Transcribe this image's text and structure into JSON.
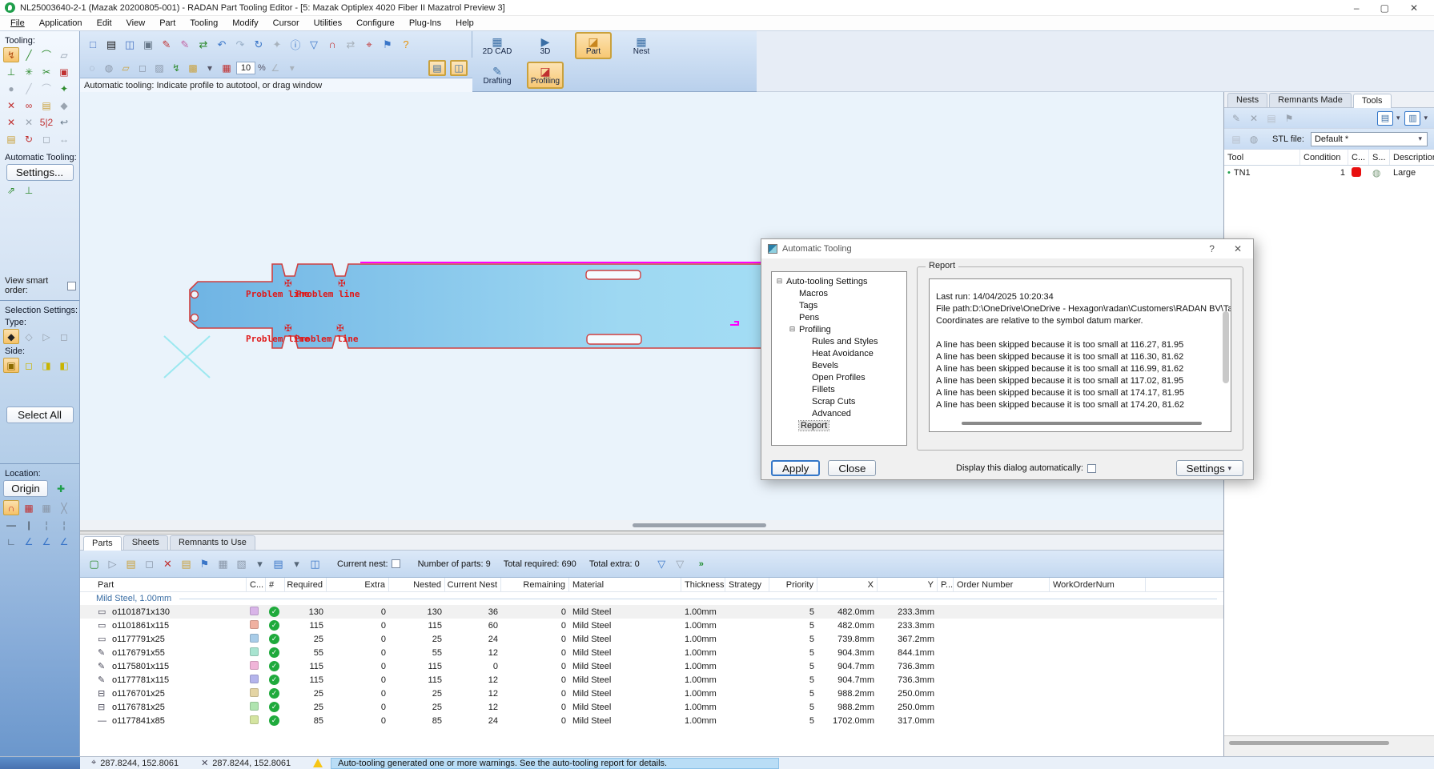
{
  "window": {
    "title": "NL25003640-2-1 (Mazak 20200805-001) - RADAN Part Tooling Editor - [5: Mazak Optiplex 4020 Fiber II Mazatrol Preview 3]",
    "minimize": "–",
    "maximize": "▢",
    "close": "✕"
  },
  "menubar": {
    "items": [
      {
        "label": "File"
      },
      {
        "label": "Application"
      },
      {
        "label": "Edit"
      },
      {
        "label": "View"
      },
      {
        "label": "Part"
      },
      {
        "label": "Tooling"
      },
      {
        "label": "Modify"
      },
      {
        "label": "Cursor"
      },
      {
        "label": "Utilities"
      },
      {
        "label": "Configure"
      },
      {
        "label": "Plug-Ins"
      },
      {
        "label": "Help"
      }
    ]
  },
  "toolbar_main": {
    "icons": [
      {
        "n": "new-file-icon",
        "g": "□",
        "c": "#4a76c4"
      },
      {
        "n": "open-file-icon",
        "g": "▤",
        "c": "#d8a padding",
        "c2": ""
      },
      {
        "n": "save-file-icon",
        "g": "◫",
        "c": "#4a76c4"
      },
      {
        "n": "print-icon",
        "g": "▣",
        "c": "#667788"
      },
      {
        "n": "edit-pencil-icon",
        "g": "✎",
        "c": "#c03030"
      },
      {
        "n": "style-pencil-icon",
        "g": "✎",
        "c": "#c060a0"
      },
      {
        "n": "swap-tools-icon",
        "g": "⇄",
        "c": "#2e8b2e"
      },
      {
        "n": "undo-icon",
        "g": "↶",
        "c": "#3a76c8"
      },
      {
        "n": "redo-icon",
        "g": "↷",
        "c": "#9ab0c8"
      },
      {
        "n": "refresh-icon",
        "g": "↻",
        "c": "#3a76c8"
      },
      {
        "n": "sparkle-icon",
        "g": "✦",
        "c": "#a8b2bc"
      },
      {
        "n": "info-icon",
        "g": "ⓘ",
        "c": "#3a76c8"
      },
      {
        "n": "filter-icon",
        "g": "▽",
        "c": "#3a76c8"
      },
      {
        "n": "magnet-icon",
        "g": "∩",
        "c": "#c03030"
      },
      {
        "n": "measure-icon",
        "g": "⇄",
        "c": "#a8b2bc"
      },
      {
        "n": "inspect-icon",
        "g": "⌖",
        "c": "#c03030"
      },
      {
        "n": "flag-icon",
        "g": "⚑",
        "c": "#3a76c8"
      },
      {
        "n": "help-icon",
        "g": "?",
        "c": "#e8940a"
      }
    ]
  },
  "toolbar_second": {
    "icons": [
      {
        "n": "ghost-select-icon",
        "g": "◌",
        "c": "#8a97a8"
      },
      {
        "n": "ghost-move-icon",
        "g": "◍",
        "c": "#8a97a8"
      },
      {
        "n": "ghost-pan-icon",
        "g": "▱",
        "c": "#caa13c"
      },
      {
        "n": "ghost-copy-icon",
        "g": "◻",
        "c": "#8a97a8"
      },
      {
        "n": "ghost-check-icon",
        "g": "▨",
        "c": "#8a97a8"
      },
      {
        "n": "flash-tool-icon",
        "g": "↯",
        "c": "#2e8b2e"
      },
      {
        "n": "home-view-icon",
        "g": "▩",
        "c": "#caa13c"
      },
      {
        "n": "dropdown-icon",
        "g": "▾",
        "c": "#556"
      },
      {
        "n": "zoom-grid-icon",
        "g": "▦",
        "c": "#c03030"
      }
    ],
    "zoom_value": "10",
    "percent": "%",
    "tail_icons": [
      {
        "n": "angle-snap-icon",
        "g": "∠",
        "c": "#a8b2bc"
      },
      {
        "n": "dropdown-icon",
        "g": "▾",
        "c": "#a8b2bc"
      }
    ],
    "toggle1": "▤",
    "toggle2": "◫"
  },
  "mode_buttons": {
    "cad": {
      "label": "2D CAD",
      "glyph": "▦"
    },
    "threed": {
      "label": "3D",
      "glyph": "▶"
    },
    "part": {
      "label": "Part",
      "glyph": "◪"
    },
    "nest": {
      "label": "Nest",
      "glyph": "▦"
    },
    "drafting": {
      "label": "Drafting",
      "glyph": "✎"
    },
    "profiling": {
      "label": "Profiling",
      "glyph": "◪"
    }
  },
  "hint": "Automatic tooling: Indicate profile to autotool, or drag window",
  "left_palette": {
    "tooling_label": "Tooling:",
    "tool_icons": [
      {
        "n": "autotool-icon",
        "g": "↯",
        "c": "#b04a10",
        "cls": "sel"
      },
      {
        "n": "tool-line-icon",
        "g": "╱",
        "c": "#2e8b2e"
      },
      {
        "n": "tool-arc-icon",
        "g": "⌒",
        "c": "#2e8b2e"
      },
      {
        "n": "tool-cam-icon",
        "g": "▱",
        "c": "#8a97a8"
      },
      {
        "n": "tool-tee-icon",
        "g": "⊥",
        "c": "#2e8b2e"
      },
      {
        "n": "tool-gear-icon",
        "g": "✳",
        "c": "#2e8b2e"
      },
      {
        "n": "tool-split-icon",
        "g": "✂",
        "c": "#2e8b2e"
      },
      {
        "n": "tool-boxed-icon",
        "g": "▣",
        "c": "#c03030"
      },
      {
        "n": "tool-dot-icon",
        "g": "●",
        "c": "#9aa4b0"
      },
      {
        "n": "tool-dash-line-icon",
        "g": "╱",
        "c": "#b8c0cc"
      },
      {
        "n": "tool-dash-arc-icon",
        "g": "⌒",
        "c": "#b8c0cc"
      },
      {
        "n": "tool-marker-icon",
        "g": "✦",
        "c": "#2e8b2e"
      },
      {
        "n": "tool-delete-icon",
        "g": "✕",
        "c": "#c03030"
      },
      {
        "n": "tool-pair-icon",
        "g": "∞",
        "c": "#c03030"
      },
      {
        "n": "tool-folder-icon",
        "g": "▤",
        "c": "#caa13c"
      },
      {
        "n": "tool-polygon-icon",
        "g": "◆",
        "c": "#9aa4b0"
      },
      {
        "n": "tool-cross-icon",
        "g": "✕",
        "c": "#c03030"
      },
      {
        "n": "tool-cross2-icon",
        "g": "✕",
        "c": "#9aa4b0"
      },
      {
        "n": "tool-size-icon",
        "g": "5|2",
        "c": "#c03030"
      },
      {
        "n": "tool-hook-icon",
        "g": "↩",
        "c": "#667788"
      },
      {
        "n": "tool-copy-icon",
        "g": "▤",
        "c": "#caa13c"
      },
      {
        "n": "tool-rotate-icon",
        "g": "↻",
        "c": "#c03030"
      },
      {
        "n": "tool-rect-icon",
        "g": "◻",
        "c": "#9aa4b0"
      },
      {
        "n": "tool-spacing-icon",
        "g": "↔",
        "c": "#9aa4b0"
      }
    ],
    "autotool_label": "Automatic Tooling:",
    "settings_button": "Settings...",
    "autotool_icons": [
      {
        "n": "autotool-run-icon",
        "g": "⇗",
        "c": "#2e8b2e"
      },
      {
        "n": "autotool-apply-icon",
        "g": "⊥",
        "c": "#2e8b2e"
      }
    ],
    "view_smart_order": "View smart order:",
    "selection_settings": "Selection Settings:",
    "type_label": "Type:",
    "type_icons": [
      {
        "n": "type-any-icon",
        "g": "◆",
        "c": "#222222",
        "cls": "sel"
      },
      {
        "n": "type-open-icon",
        "g": "◇",
        "c": "#98a2ae"
      },
      {
        "n": "type-closed-icon",
        "g": "▷",
        "c": "#98a2ae"
      },
      {
        "n": "type-text-icon",
        "g": "◻",
        "c": "#98a2ae"
      }
    ],
    "side_label": "Side:",
    "side_icons": [
      {
        "n": "side-auto-icon",
        "g": "▣",
        "c": "#8a6a00",
        "cls": "sel"
      },
      {
        "n": "side-left-icon",
        "g": "◻",
        "c": "#c8b400"
      },
      {
        "n": "side-on-icon",
        "g": "◨",
        "c": "#c8b400"
      },
      {
        "n": "side-right-icon",
        "g": "◧",
        "c": "#c8b400"
      }
    ],
    "select_all_button": "Select All",
    "location_label": "Location:",
    "origin_button": "Origin",
    "origin_icon": {
      "n": "origin-cross-icon",
      "g": "✚",
      "c": "#1e9e4a"
    },
    "location_icons": [
      {
        "n": "snap-magnet-icon",
        "g": "∩",
        "c": "#c03030",
        "cls": "sel"
      },
      {
        "n": "grid-red-icon",
        "g": "▦",
        "c": "#c03030"
      },
      {
        "n": "grid-snap-icon",
        "g": "▦",
        "c": "#8a97a8"
      },
      {
        "n": "grid-angle-icon",
        "g": "╳",
        "c": "#8a97a8"
      },
      {
        "n": "line-h-icon",
        "g": "—",
        "c": "#222222"
      },
      {
        "n": "line-v-icon",
        "g": "|",
        "c": "#222222"
      },
      {
        "n": "line-corner-icon",
        "g": "¦",
        "c": "#667788"
      },
      {
        "n": "line-dash-icon",
        "g": "¦",
        "c": "#667788"
      },
      {
        "n": "axes-icon",
        "g": "∟",
        "c": "#445566"
      },
      {
        "n": "angle1-icon",
        "g": "∠",
        "c": "#3a76c8"
      },
      {
        "n": "angle2-icon",
        "g": "∠",
        "c": "#3a76c8"
      },
      {
        "n": "angle3-icon",
        "g": "∠",
        "c": "#3a76c8"
      }
    ]
  },
  "canvas": {
    "problem_label": "Problem line"
  },
  "dialog": {
    "title": "Automatic Tooling",
    "help": "?",
    "close": "✕",
    "tree": [
      {
        "label": "Auto-tooling Settings",
        "cls": "lvl-0",
        "exp": "⊟"
      },
      {
        "label": "Macros",
        "cls": "lvl-1",
        "exp": ""
      },
      {
        "label": "Tags",
        "cls": "lvl-1",
        "exp": ""
      },
      {
        "label": "Pens",
        "cls": "lvl-1",
        "exp": ""
      },
      {
        "label": "Profiling",
        "cls": "lvl-1",
        "exp": "⊟"
      },
      {
        "label": "Rules and Styles",
        "cls": "lvl-2",
        "exp": ""
      },
      {
        "label": "Heat Avoidance",
        "cls": "lvl-2",
        "exp": ""
      },
      {
        "label": "Bevels",
        "cls": "lvl-2",
        "exp": ""
      },
      {
        "label": "Open Profiles",
        "cls": "lvl-2",
        "exp": ""
      },
      {
        "label": "Fillets",
        "cls": "lvl-2",
        "exp": ""
      },
      {
        "label": "Scrap Cuts",
        "cls": "lvl-2",
        "exp": ""
      },
      {
        "label": "Advanced",
        "cls": "lvl-2",
        "exp": ""
      },
      {
        "label": "Report",
        "cls": "lvl-1",
        "exp": "",
        "lcls": "sel"
      }
    ],
    "group_label": "Report",
    "report_lines": [
      {
        "t": ""
      },
      {
        "t": "Last run: 14/04/2025 10:20:34"
      },
      {
        "t": "File path:D:\\OneDrive\\OneDrive - Hexagon\\radan\\Customers\\RADAN BV\\Tailors"
      },
      {
        "t": "Coordinates are relative to the symbol datum marker."
      },
      {
        "t": ""
      },
      {
        "t": "A line has been skipped because it is too small at 116.27, 81.95"
      },
      {
        "t": "A line has been skipped because it is too small at 116.30, 81.62"
      },
      {
        "t": "A line has been skipped because it is too small at 116.99, 81.62"
      },
      {
        "t": "A line has been skipped because it is too small at 117.02, 81.95"
      },
      {
        "t": "A line has been skipped because it is too small at 174.17, 81.95"
      },
      {
        "t": "A line has been skipped because it is too small at 174.20, 81.62"
      }
    ],
    "apply_button": "Apply",
    "close_button": "Close",
    "display_check_label": "Display this dialog automatically:",
    "settings_button": "Settings",
    "settings_arrow": "▾"
  },
  "parts_panel": {
    "tabs": [
      {
        "label": "Parts",
        "cls": "active"
      },
      {
        "label": "Sheets"
      },
      {
        "label": "Remnants to Use"
      }
    ],
    "toolbar_icons": [
      {
        "n": "add-part-icon",
        "g": "▢",
        "c": "#2e8b2e"
      },
      {
        "n": "export-part-icon",
        "g": "▷",
        "c": "#8a97a8"
      },
      {
        "n": "import-part-icon",
        "g": "▤",
        "c": "#caa13c"
      },
      {
        "n": "copy-part-icon",
        "g": "◻",
        "c": "#8a97a8"
      },
      {
        "n": "delete-part-icon",
        "g": "✕",
        "c": "#c03030"
      },
      {
        "n": "open-part-icon",
        "g": "▤",
        "c": "#caa13c"
      },
      {
        "n": "flag-part-icon",
        "g": "⚑",
        "c": "#3a76c8"
      },
      {
        "n": "grid-view-icon",
        "g": "▦",
        "c": "#8a97a8"
      },
      {
        "n": "chart-view-icon",
        "g": "▧",
        "c": "#8a97a8"
      },
      {
        "n": "dropdown-icon",
        "g": "▾",
        "c": "#556677"
      },
      {
        "n": "view-list-icon",
        "g": "▤",
        "c": "#3a76c8"
      },
      {
        "n": "dropdown-icon",
        "g": "▾",
        "c": "#556677"
      },
      {
        "n": "view-detail-icon",
        "g": "◫",
        "c": "#3a76c8"
      }
    ],
    "current_nest_label": "Current nest:",
    "counts": {
      "parts": "Number of parts: 9",
      "required": "Total required: 690",
      "extra": "Total extra: 0"
    },
    "filter_on_icon": "▽",
    "filter_off_icon": "▽",
    "more_chevron": "»",
    "columns": [
      "Part",
      "C...",
      "#",
      "Required",
      "Extra",
      "Nested",
      "Current Nest",
      "Remaining",
      "Material",
      "Thickness",
      "Strategy",
      "Priority",
      "X",
      "Y",
      "P...",
      "Order Number",
      "WorkOrderNum"
    ],
    "group_label": "Mild Steel, 1.00mm",
    "rows": [
      {
        "g": "▭",
        "swatch": "#d8b4e8",
        "name": "o1101871x130",
        "required": "130",
        "extra": "0",
        "nested": "130",
        "current": "36",
        "remaining": "0",
        "material": "Mild Steel",
        "thickness": "1.00mm",
        "strategy": "",
        "priority": "5",
        "x": "482.0mm",
        "y": "233.3mm",
        "cls": "hl"
      },
      {
        "g": "▭",
        "swatch": "#f0b0a0",
        "name": "o1101861x115",
        "required": "115",
        "extra": "0",
        "nested": "115",
        "current": "60",
        "remaining": "0",
        "material": "Mild Steel",
        "thickness": "1.00mm",
        "strategy": "",
        "priority": "5",
        "x": "482.0mm",
        "y": "233.3mm"
      },
      {
        "g": "▭",
        "swatch": "#a8cce8",
        "name": "o1177791x25",
        "required": "25",
        "extra": "0",
        "nested": "25",
        "current": "24",
        "remaining": "0",
        "material": "Mild Steel",
        "thickness": "1.00mm",
        "strategy": "",
        "priority": "5",
        "x": "739.8mm",
        "y": "367.2mm"
      },
      {
        "g": "✎",
        "swatch": "#a8e4d0",
        "name": "o1176791x55",
        "required": "55",
        "extra": "0",
        "nested": "55",
        "current": "12",
        "remaining": "0",
        "material": "Mild Steel",
        "thickness": "1.00mm",
        "strategy": "",
        "priority": "5",
        "x": "904.3mm",
        "y": "844.1mm"
      },
      {
        "g": "✎",
        "swatch": "#f0b4d8",
        "name": "o1175801x115",
        "required": "115",
        "extra": "0",
        "nested": "115",
        "current": "0",
        "remaining": "0",
        "material": "Mild Steel",
        "thickness": "1.00mm",
        "strategy": "",
        "priority": "5",
        "x": "904.7mm",
        "y": "736.3mm"
      },
      {
        "g": "✎",
        "swatch": "#b4b4ec",
        "name": "o1177781x115",
        "required": "115",
        "extra": "0",
        "nested": "115",
        "current": "12",
        "remaining": "0",
        "material": "Mild Steel",
        "thickness": "1.00mm",
        "strategy": "",
        "priority": "5",
        "x": "904.7mm",
        "y": "736.3mm"
      },
      {
        "g": "⊟",
        "swatch": "#e4d4a4",
        "name": "o1176701x25",
        "required": "25",
        "extra": "0",
        "nested": "25",
        "current": "12",
        "remaining": "0",
        "material": "Mild Steel",
        "thickness": "1.00mm",
        "strategy": "",
        "priority": "5",
        "x": "988.2mm",
        "y": "250.0mm"
      },
      {
        "g": "⊟",
        "swatch": "#b0e4b0",
        "name": "o1176781x25",
        "required": "25",
        "extra": "0",
        "nested": "25",
        "current": "12",
        "remaining": "0",
        "material": "Mild Steel",
        "thickness": "1.00mm",
        "strategy": "",
        "priority": "5",
        "x": "988.2mm",
        "y": "250.0mm"
      },
      {
        "g": "—",
        "swatch": "#d4e4a0",
        "name": "o1177841x85",
        "required": "85",
        "extra": "0",
        "nested": "85",
        "current": "24",
        "remaining": "0",
        "material": "Mild Steel",
        "thickness": "1.00mm",
        "strategy": "",
        "priority": "5",
        "x": "1702.0mm",
        "y": "317.0mm"
      }
    ]
  },
  "right_panel": {
    "tabs": [
      {
        "label": "Nests"
      },
      {
        "label": "Remnants Made"
      },
      {
        "label": "Tools",
        "cls": "active"
      }
    ],
    "toolbar1_icons": [
      {
        "n": "edit-tool-icon",
        "g": "✎",
        "c": "#98a2ae"
      },
      {
        "n": "delete-tool-icon",
        "g": "✕",
        "c": "#98a2ae"
      },
      {
        "n": "open-tool-icon",
        "g": "▤",
        "c": "#b8c0cc"
      },
      {
        "n": "flag-tool-icon",
        "g": "⚑",
        "c": "#98a2ae"
      }
    ],
    "view1_icon": "▤",
    "view2_icon": "▥",
    "dd": "▾",
    "toolbar2_icons": [
      {
        "n": "import-stl-icon",
        "g": "▤",
        "c": "#b8c0cc"
      },
      {
        "n": "stl-globe-icon",
        "g": "◍",
        "c": "#98a2ae"
      }
    ],
    "stl_label": "STL file:",
    "stl_value": "Default *",
    "columns": [
      "Tool",
      "Condition",
      "C...",
      "S...",
      "Description"
    ],
    "row": {
      "tool": "TN1",
      "condition": "1",
      "swatch": "#e81010",
      "desc": "Large"
    }
  },
  "statusbar": {
    "coords1": "287.8244, 152.8061",
    "coords2": "287.8244, 152.8061",
    "warning": "Auto-tooling generated one or more warnings. See the auto-tooling report for details."
  },
  "colors": {
    "accent_orange": "#f0a030",
    "selection_blue": "#3577c8",
    "part_outline": "#d04040",
    "part_fill_light": "#c2ecfc",
    "part_fill_dark": "#7ec2ec",
    "magenta": "#ff00ff",
    "datum_cyan": "#9ce8f0",
    "warning_yellow": "#f6c514",
    "check_green": "#1faa3c",
    "group_text": "#3a6ea5"
  }
}
